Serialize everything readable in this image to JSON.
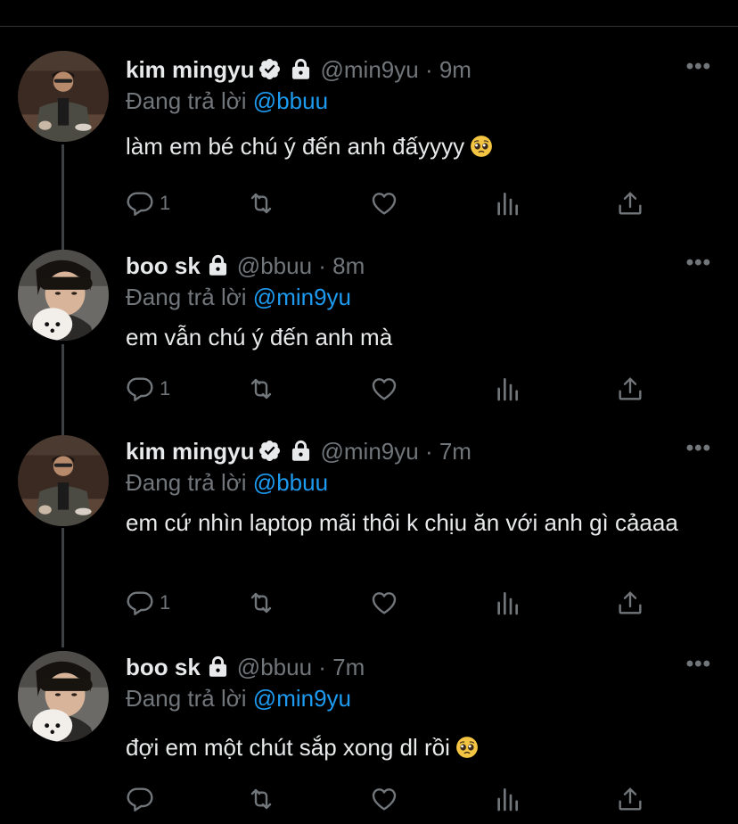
{
  "colors": {
    "background": "#000000",
    "text": "#e7e9ea",
    "muted": "#71767b",
    "accent": "#1d9bf0",
    "thread_line": "#3e4144"
  },
  "tweets": [
    {
      "name": "kim mingyu",
      "verified": true,
      "protected": true,
      "handle": "@min9yu",
      "dot": "·",
      "time": "9m",
      "reply_prefix": "Đang trả lời",
      "reply_to": "@bbuu",
      "text": "làm em bé chú ý đến anh đấyyyy",
      "emoji": "pleading-face",
      "reply_count": "1",
      "more_label": "•••",
      "avatar": "avatar-mingyu"
    },
    {
      "name": "boo sk",
      "verified": false,
      "protected": true,
      "handle": "@bbuu",
      "dot": "·",
      "time": "8m",
      "reply_prefix": "Đang trả lời",
      "reply_to": "@min9yu",
      "text": "em vẫn chú ý đến anh mà",
      "emoji": "",
      "reply_count": "1",
      "more_label": "•••",
      "avatar": "avatar-boo"
    },
    {
      "name": "kim mingyu",
      "verified": true,
      "protected": true,
      "handle": "@min9yu",
      "dot": "·",
      "time": "7m",
      "reply_prefix": "Đang trả lời",
      "reply_to": "@bbuu",
      "text": "em cứ nhìn laptop mãi thôi k chịu ăn với anh gì cảaaa",
      "emoji": "",
      "reply_count": "1",
      "more_label": "•••",
      "avatar": "avatar-mingyu"
    },
    {
      "name": "boo sk",
      "verified": false,
      "protected": true,
      "handle": "@bbuu",
      "dot": "·",
      "time": "7m",
      "reply_prefix": "Đang trả lời",
      "reply_to": "@min9yu",
      "text": "đợi em một chút sắp xong dl rồi",
      "emoji": "pleading-face",
      "reply_count": "",
      "more_label": "•••",
      "avatar": "avatar-boo"
    }
  ]
}
